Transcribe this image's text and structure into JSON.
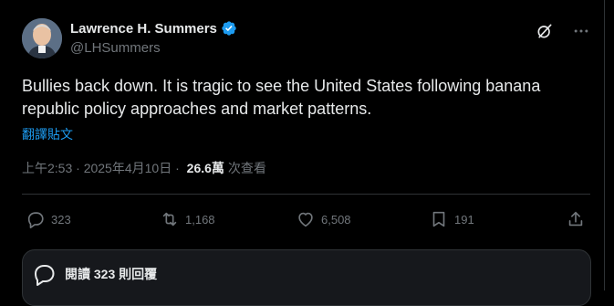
{
  "author": {
    "name": "Lawrence H. Summers",
    "handle": "@LHSummers"
  },
  "tweet": {
    "text": "Bullies back down. It is tragic to see the United States following banana republic policy approaches and market patterns.",
    "translate_label": "翻譯貼文",
    "time": "上午2:53",
    "separator": " · ",
    "date": "2025年4月10日",
    "separator2": " · ",
    "views_count": "26.6萬",
    "views_label": "次查看"
  },
  "actions": {
    "reply_count": "323",
    "retweet_count": "1,168",
    "like_count": "6,508",
    "bookmark_count": "191"
  },
  "reply_prompt": {
    "label": "閱讀 323 則回覆"
  },
  "colors": {
    "background": "#000000",
    "text": "#e7e9ea",
    "secondary": "#71767b",
    "link": "#1d9bf0",
    "verified": "#1d9bf0",
    "border": "#2f3336"
  }
}
